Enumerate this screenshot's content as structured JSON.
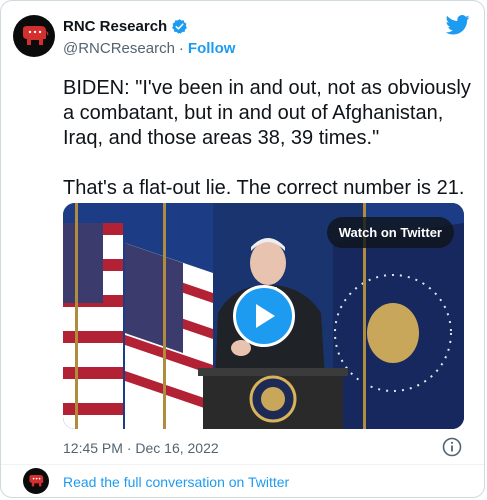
{
  "account": {
    "name": "RNC Research",
    "handle": "@RNCResearch",
    "separator": "·",
    "follow_label": "Follow",
    "avatar_icon": "elephant-logo-icon",
    "verified_icon": "verified-badge-icon"
  },
  "tweet": {
    "paragraphs": [
      "BIDEN: \"I've been in and out, not as obviously a combatant, but in and out of Afghanistan, Iraq, and those areas 38, 39 times.\"",
      "That's a flat-out lie. The correct number is 21."
    ],
    "timestamp": "12:45 PM · Dec 16, 2022"
  },
  "media": {
    "watch_label": "Watch on Twitter",
    "play_icon": "play-icon"
  },
  "footer": {
    "read_label": "Read the full conversation on Twitter"
  },
  "colors": {
    "accent": "#1d9bf0",
    "text": "#0f1419",
    "muted": "#536471",
    "border": "#cfd9de",
    "logo_red": "#d32f2f"
  }
}
